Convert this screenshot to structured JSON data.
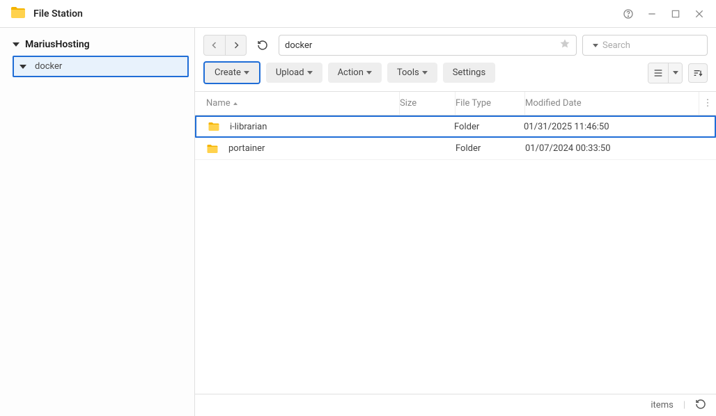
{
  "app": {
    "title": "File Station"
  },
  "sidebar": {
    "root": "MariusHosting",
    "child": "docker"
  },
  "path": {
    "value": "docker"
  },
  "search": {
    "placeholder": "Search"
  },
  "toolbar": {
    "create": "Create",
    "upload": "Upload",
    "action": "Action",
    "tools": "Tools",
    "settings": "Settings"
  },
  "columns": {
    "name": "Name",
    "size": "Size",
    "type": "File Type",
    "date": "Modified Date"
  },
  "rows": [
    {
      "name": "i-librarian",
      "type": "Folder",
      "date": "01/31/2025 11:46:50",
      "highlight": true
    },
    {
      "name": "portainer",
      "type": "Folder",
      "date": "01/07/2024 00:33:50",
      "highlight": false
    }
  ],
  "status": {
    "items": "items"
  }
}
